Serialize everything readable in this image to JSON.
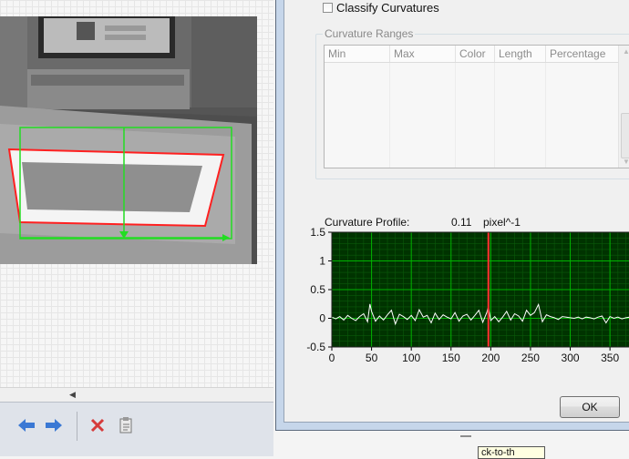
{
  "dialog": {
    "classify_checkbox": {
      "label": "Classify Curvatures",
      "checked": false
    },
    "curvature_ranges": {
      "title": "Curvature Ranges",
      "columns": [
        "Min",
        "Max",
        "Color",
        "Length",
        "Percentage"
      ],
      "rows": []
    },
    "profile": {
      "label": "Curvature Profile:",
      "value": "0.11",
      "unit": "pixel^-1"
    },
    "ok_label": "OK"
  },
  "tooltip": {
    "text": "ck-to-th"
  },
  "icons": {
    "back": "arrow-left-icon",
    "forward": "arrow-right-icon",
    "delete": "close-x-icon",
    "clipboard": "clipboard-icon"
  },
  "colors": {
    "chart_bg": "#003300",
    "chart_grid": "#00b300",
    "signal": "#ffffff",
    "cursor": "#ff3030",
    "roi_box": "#22dd22",
    "contour": "#ff2020"
  },
  "chart_data": {
    "type": "line",
    "title": "",
    "xlabel": "",
    "ylabel": "",
    "xlim": [
      0,
      390
    ],
    "ylim": [
      -0.5,
      1.5
    ],
    "x_ticks": [
      0,
      50,
      100,
      150,
      200,
      250,
      300,
      350
    ],
    "y_ticks": [
      1.5,
      1,
      0.5,
      0,
      -0.5
    ],
    "cursor_x": 197,
    "grid": true,
    "series": [
      {
        "x": [
          0,
          5,
          10,
          15,
          20,
          25,
          30,
          35,
          40,
          45,
          48,
          50,
          55,
          60,
          65,
          70,
          75,
          80,
          85,
          90,
          95,
          100,
          105,
          110,
          115,
          120,
          125,
          130,
          135,
          140,
          145,
          150,
          155,
          160,
          165,
          170,
          175,
          180,
          185,
          190,
          195,
          197,
          200,
          205,
          210,
          215,
          220,
          225,
          230,
          235,
          240,
          245,
          250,
          255,
          260,
          265,
          270,
          275,
          280,
          285,
          290,
          295,
          300,
          305,
          310,
          315,
          320,
          325,
          330,
          335,
          340,
          345,
          350,
          355,
          360,
          365,
          370,
          375,
          380,
          385,
          390
        ],
        "y": [
          0.02,
          -0.01,
          0.03,
          -0.03,
          0.05,
          0,
          -0.04,
          0.03,
          0.08,
          -0.06,
          0.25,
          0.12,
          -0.05,
          0.04,
          -0.03,
          0.06,
          0.14,
          -0.1,
          0.07,
          0.03,
          -0.02,
          0.05,
          -0.04,
          0.15,
          0.02,
          0.05,
          -0.08,
          0.09,
          -0.02,
          0.06,
          0.02,
          -0.01,
          0.1,
          -0.05,
          0.04,
          0.07,
          -0.03,
          0.05,
          0.14,
          -0.07,
          0.1,
          0.2,
          -0.04,
          0.03,
          -0.06,
          0.02,
          0.12,
          -0.03,
          0.08,
          0.04,
          -0.05,
          0.14,
          0.05,
          0.1,
          0.24,
          -0.06,
          0.06,
          0.03,
          0.01,
          -0.02,
          0.03,
          0.02,
          0.01,
          0,
          0.02,
          -0.01,
          0.02,
          0.01,
          -0.01,
          0.02,
          0.04,
          -0.08,
          0.03,
          0,
          0.02,
          -0.01,
          0.01,
          0.02,
          -0.02,
          0.01,
          0
        ]
      }
    ]
  }
}
